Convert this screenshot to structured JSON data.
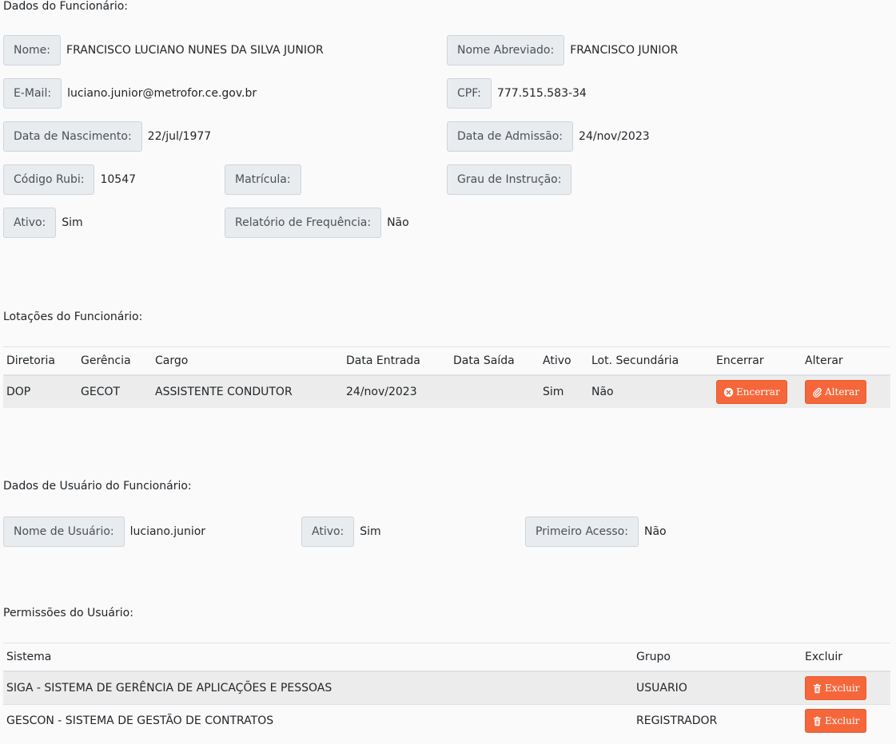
{
  "sections": {
    "employee": "Dados do Funcionário:",
    "lotacoes": "Lotações do Funcionário:",
    "user": "Dados de Usuário do Funcionário:",
    "permissions": "Permissões do Usuário:"
  },
  "employee": {
    "nome": {
      "label": "Nome:",
      "value": "FRANCISCO LUCIANO NUNES DA SILVA JUNIOR"
    },
    "nome_abreviado": {
      "label": "Nome Abreviado:",
      "value": "FRANCISCO JUNIOR"
    },
    "email": {
      "label": "E-Mail:",
      "value": "luciano.junior@metrofor.ce.gov.br"
    },
    "cpf": {
      "label": "CPF:",
      "value": "777.515.583-34"
    },
    "nascimento": {
      "label": "Data de Nascimento:",
      "value": "22/jul/1977"
    },
    "admissao": {
      "label": "Data de Admissão:",
      "value": "24/nov/2023"
    },
    "codigo_rubi": {
      "label": "Código Rubi:",
      "value": "10547"
    },
    "matricula": {
      "label": "Matrícula:",
      "value": ""
    },
    "grau": {
      "label": "Grau de Instrução:",
      "value": ""
    },
    "ativo": {
      "label": "Ativo:",
      "value": "Sim"
    },
    "relatorio": {
      "label": "Relatório de Frequência:",
      "value": "Não"
    }
  },
  "lotacoes": {
    "headers": [
      "Diretoria",
      "Gerência",
      "Cargo",
      "Data Entrada",
      "Data Saída",
      "Ativo",
      "Lot. Secundária",
      "Encerrar",
      "Alterar"
    ],
    "rows": [
      {
        "diretoria": "DOP",
        "gerencia": "GECOT",
        "cargo": "ASSISTENTE CONDUTOR",
        "entrada": "24/nov/2023",
        "saida": "",
        "ativo": "Sim",
        "secundaria": "Não",
        "encerrar": "Encerrar",
        "alterar": "Alterar"
      }
    ]
  },
  "user": {
    "nome_usuario": {
      "label": "Nome de Usuário:",
      "value": "luciano.junior"
    },
    "ativo": {
      "label": "Ativo:",
      "value": "Sim"
    },
    "primeiro_acesso": {
      "label": "Primeiro Acesso:",
      "value": "Não"
    }
  },
  "permissions": {
    "headers": [
      "Sistema",
      "Grupo",
      "Excluir"
    ],
    "rows": [
      {
        "sistema": "SIGA - SISTEMA DE GERÊNCIA DE APLICAÇÕES E PESSOAS",
        "grupo": "USUARIO",
        "excluir": "Excluir"
      },
      {
        "sistema": "GESCON - SISTEMA DE GESTÃO DE CONTRATOS",
        "grupo": "REGISTRADOR",
        "excluir": "Excluir"
      }
    ]
  },
  "colors": {
    "accent": "#f5673b",
    "label_bg": "#e9ecef"
  },
  "icons": {
    "encerrar": "times-circle-icon",
    "alterar": "paperclip-icon",
    "excluir": "trash-icon"
  }
}
